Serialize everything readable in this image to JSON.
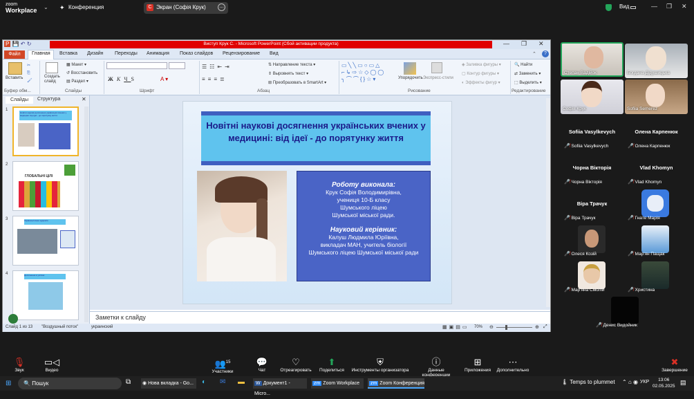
{
  "zoom": {
    "logo_top": "zoom",
    "logo_bottom": "Workplace",
    "conference_label": "Конференция",
    "screen_label": "Экран (Софія Крук)",
    "view_label": "Вид"
  },
  "ppt": {
    "window_title": "Виступ Крук С. - Microsoft PowerPoint (Сбой активации продукта)",
    "tabs": [
      "Файл",
      "Главная",
      "Вставка",
      "Дизайн",
      "Переходы",
      "Анимация",
      "Показ слайдов",
      "Рецензирование",
      "Вид"
    ],
    "ribbon": {
      "paste": "Вставить",
      "clipboard_group": "Буфер обм...",
      "create_slide": "Создать слайд",
      "layout": "Макет",
      "restore": "Восстановить",
      "section": "Раздел",
      "slides_group": "Слайды",
      "font_group": "Шрифт",
      "paragraph_group": "Абзац",
      "text_direction": "Направление текста",
      "align_text": "Выровнять текст",
      "convert_smartart": "Преобразовать в SmartArt",
      "arrange": "Упорядочить",
      "express_styles": "Экспресс-стили",
      "drawing_group": "Рисование",
      "shape_fill": "Заливка фигуры",
      "shape_outline": "Контур фигуры",
      "shape_effects": "Эффекты фигур",
      "find": "Найти",
      "replace": "Заменить",
      "select": "Выделить",
      "editing_group": "Редактирование"
    },
    "panel_tabs": [
      "Слайды",
      "Структура"
    ],
    "slide": {
      "title": "Новітні наукові досягнення українських вчених у медицині: від ідеї - до порятунку життя",
      "work_heading": "Роботу виконала:",
      "work_lines": [
        "Крук Софія Володимирівна,",
        "учениця 10-Б класу",
        "Шумського ліцею",
        "Шумської міської ради."
      ],
      "advisor_heading": "Науковий керівник:",
      "advisor_lines": [
        "Калуш Людмила Юріївна,",
        "викладач МАН, учитель біології",
        "Шумського ліцею Шумської міської ради"
      ]
    },
    "thumb_titles": [
      "Новітні наукові досягнення українських вчених у медицині: від ідеї - до порятунку життя",
      "ГЛОБАЛЬНІ ЦІЛІ",
      "Українські вчені здоров'я",
      "Досягнення в успіхах"
    ],
    "notes_placeholder": "Заметки к слайду",
    "status": {
      "slide_of": "Слайд 1 из 13",
      "theme": "\"Воздушный поток\"",
      "language": "украинский",
      "zoom": "70%"
    }
  },
  "participants": [
    {
      "name": "Степан Вадійок"
    },
    {
      "name": "Богдана Дідушицька"
    },
    {
      "name": "Софія Крук"
    },
    {
      "name": "Sofiia Semerez"
    },
    {
      "big": "Sofiia Vasylkevych",
      "name": "Sofiia Vasylkevych"
    },
    {
      "big": "Олена Карпенюк",
      "name": "Олена Карпенюк"
    },
    {
      "big": "Чорна Вікторія",
      "name": "Чорна Вікторія"
    },
    {
      "big": "Vlad Khomyn",
      "name": "Vlad Khomyn"
    },
    {
      "big": "Віра Трачук",
      "name": "Віра Трачук"
    },
    {
      "name": "Гнате Марія"
    },
    {
      "name": "Олеся Козій"
    },
    {
      "name": "Мар'ян Пащак"
    },
    {
      "name": "Мар'яна Смолій"
    },
    {
      "name": "Христина"
    },
    {
      "name": "Денис Видойник"
    }
  ],
  "toolbar": {
    "audio": "Звук",
    "video": "Видео",
    "participants": "Участники",
    "participants_count": "15",
    "chat": "Чат",
    "react": "Отреагировать",
    "share": "Поделиться",
    "host_tools": "Инструменты организатора",
    "meeting_data": "Данные конференции",
    "apps": "Приложения",
    "more": "Дополнительно",
    "end": "Завершение"
  },
  "taskbar": {
    "search": "Пошук",
    "chrome": "Нова вкладка - Go...",
    "word": "Документ1 - Micro...",
    "zoom1": "Zoom Workplace",
    "zoom2": "Zoom Конференция",
    "weather": "Temps to plummet",
    "lang": "УКР",
    "time": "13:06",
    "date": "02.05.2025"
  }
}
